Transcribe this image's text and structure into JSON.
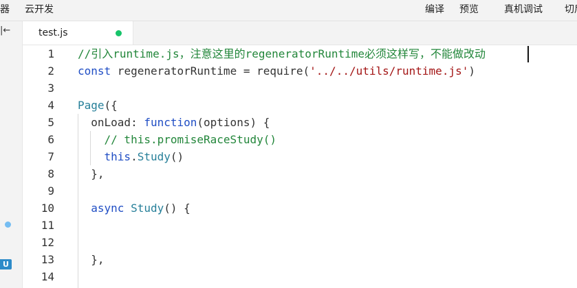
{
  "menubar": {
    "items": [
      "器",
      "云开发",
      "编译",
      "预览",
      "真机调试",
      "切后"
    ]
  },
  "sidebar": {
    "collapse_glyph": "|←",
    "badge_label": "U"
  },
  "tab": {
    "filename": "test.js",
    "modified_color": "#17c46a"
  },
  "editor": {
    "lines": [
      {
        "n": "1",
        "tokens": [
          {
            "t": "//引入runtime.js，注意这里的regeneratorRuntime必须这样写，不能做改动",
            "c": "c-comment"
          }
        ]
      },
      {
        "n": "2",
        "tokens": [
          {
            "t": "const",
            "c": "c-key"
          },
          {
            "t": " regeneratorRuntime = require(",
            "c": ""
          },
          {
            "t": "'../../utils/runtime.js'",
            "c": "c-str"
          },
          {
            "t": ")",
            "c": ""
          }
        ]
      },
      {
        "n": "3",
        "tokens": []
      },
      {
        "n": "4",
        "tokens": [
          {
            "t": "Page",
            "c": "c-type"
          },
          {
            "t": "({",
            "c": ""
          }
        ]
      },
      {
        "n": "5",
        "tokens": [
          {
            "t": "  onLoad: ",
            "c": ""
          },
          {
            "t": "function",
            "c": "c-key"
          },
          {
            "t": "(options) {",
            "c": ""
          }
        ]
      },
      {
        "n": "6",
        "tokens": [
          {
            "t": "    // this.promiseRaceStudy()",
            "c": "c-comment"
          }
        ]
      },
      {
        "n": "7",
        "tokens": [
          {
            "t": "    ",
            "c": ""
          },
          {
            "t": "this",
            "c": "c-key"
          },
          {
            "t": ".",
            "c": ""
          },
          {
            "t": "Study",
            "c": "c-fn"
          },
          {
            "t": "()",
            "c": ""
          }
        ]
      },
      {
        "n": "8",
        "tokens": [
          {
            "t": "  },",
            "c": ""
          }
        ]
      },
      {
        "n": "9",
        "tokens": []
      },
      {
        "n": "10",
        "tokens": [
          {
            "t": "  ",
            "c": ""
          },
          {
            "t": "async",
            "c": "c-key"
          },
          {
            "t": " ",
            "c": ""
          },
          {
            "t": "Study",
            "c": "c-fn"
          },
          {
            "t": "() {",
            "c": ""
          }
        ]
      },
      {
        "n": "11",
        "tokens": []
      },
      {
        "n": "12",
        "tokens": []
      },
      {
        "n": "13",
        "tokens": [
          {
            "t": "  },",
            "c": ""
          }
        ]
      },
      {
        "n": "14",
        "tokens": []
      }
    ]
  }
}
